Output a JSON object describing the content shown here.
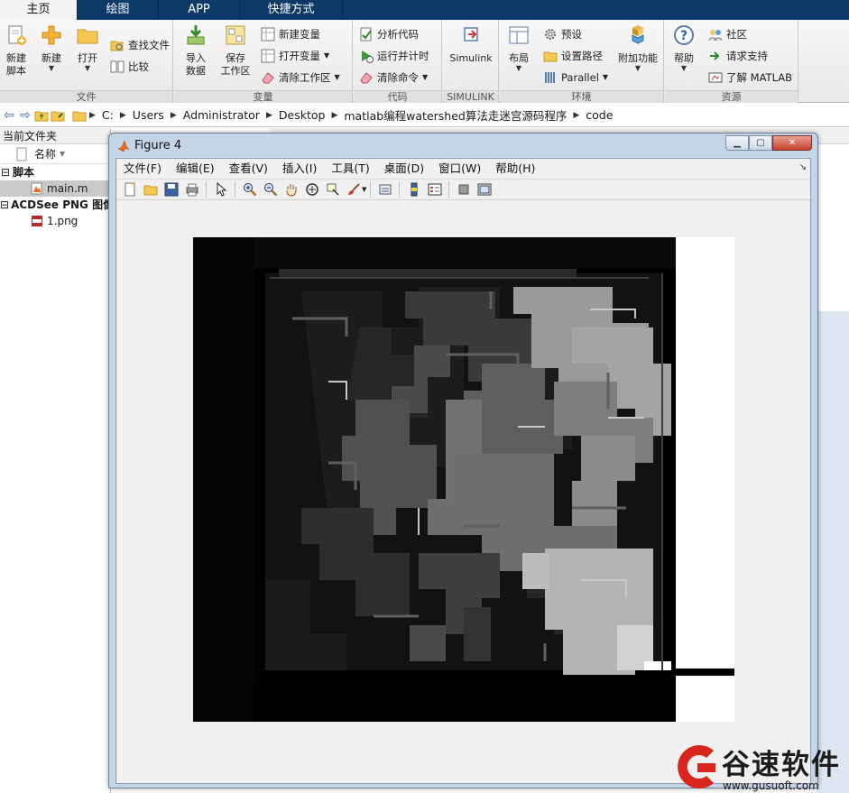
{
  "tabs": [
    {
      "label": "主页",
      "active": true
    },
    {
      "label": "绘图",
      "active": false
    },
    {
      "label": "APP",
      "active": false
    },
    {
      "label": "快捷方式",
      "active": false
    }
  ],
  "ribbon": {
    "file": {
      "label": "文件",
      "new_script": "新建\n脚本",
      "new": "新建",
      "open": "打开",
      "find_files": "查找文件",
      "compare": "比较"
    },
    "variable": {
      "label": "变量",
      "import": "导入\n数据",
      "save_ws": "保存\n工作区",
      "new_var": "新建变量",
      "open_var": "打开变量",
      "clear_ws": "清除工作区"
    },
    "code": {
      "label": "代码",
      "analyze": "分析代码",
      "run_time": "运行并计时",
      "clear_cmd": "清除命令"
    },
    "simulink": {
      "label": "SIMULINK",
      "simulink": "Simulink"
    },
    "env": {
      "label": "环境",
      "layout": "布局",
      "prefs": "预设",
      "set_path": "设置路径",
      "parallel": "Parallel",
      "addons": "附加功能"
    },
    "res": {
      "label": "资源",
      "help": "帮助",
      "community": "社区",
      "support": "请求支持",
      "learn": "了解 MATLAB"
    }
  },
  "address": {
    "crumbs": [
      "C:",
      "Users",
      "Administrator",
      "Desktop",
      "matlab编程watershed算法走迷宫源码程序",
      "code"
    ]
  },
  "file_panel": {
    "title": "当前文件夹",
    "col_name": "名称",
    "groups": [
      {
        "label": "脚本",
        "files": [
          "main.m"
        ]
      },
      {
        "label": "ACDSee PNG 图像",
        "files": [
          "1.png"
        ]
      }
    ]
  },
  "figure": {
    "title": "Figure 4",
    "menus": [
      "文件(F)",
      "编辑(E)",
      "查看(V)",
      "插入(I)",
      "工具(T)",
      "桌面(D)",
      "窗口(W)",
      "帮助(H)"
    ]
  },
  "watermark": {
    "text": "谷速软件",
    "url": "www.gusuoft.com",
    "color": "#d9261c"
  },
  "colors": {
    "titlebar": "#0d3a66",
    "accent": "#3a64a8"
  }
}
